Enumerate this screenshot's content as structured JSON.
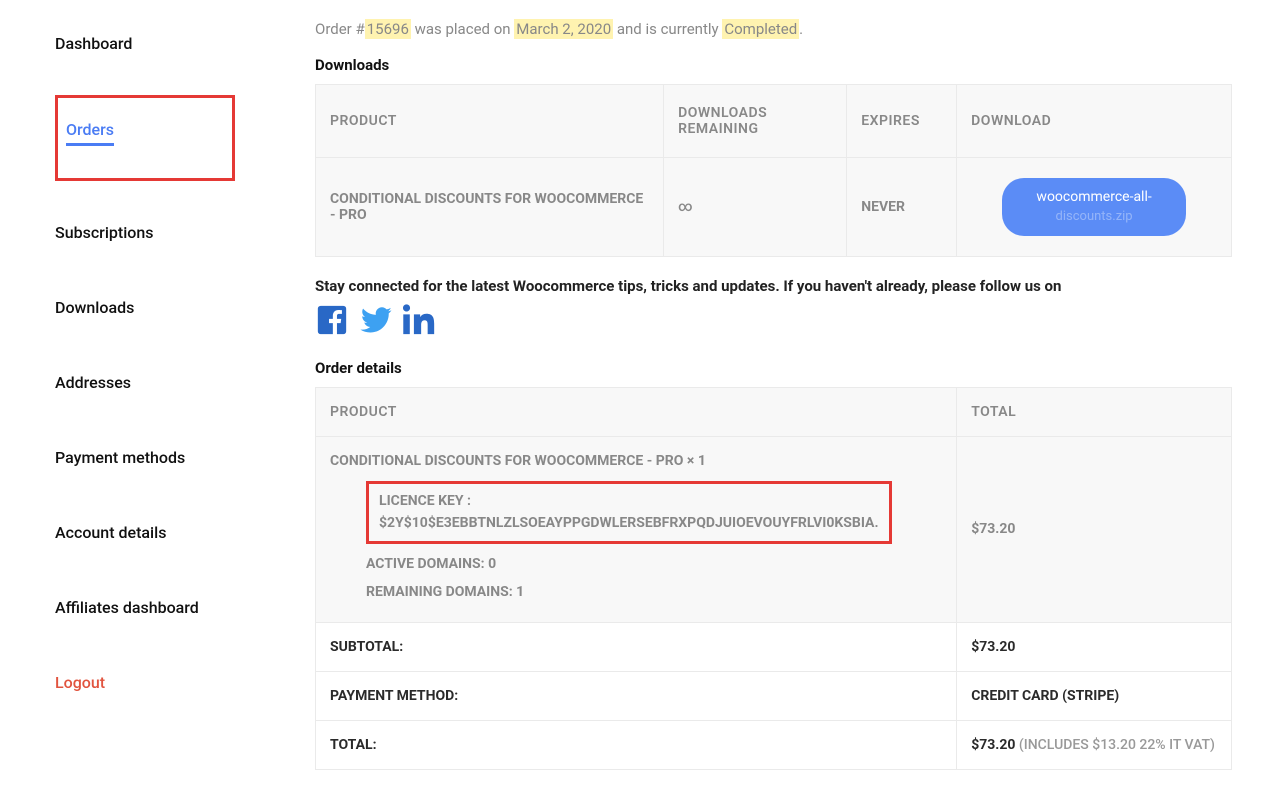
{
  "sidebar": {
    "items": [
      {
        "label": "Dashboard"
      },
      {
        "label": "Orders"
      },
      {
        "label": "Subscriptions"
      },
      {
        "label": "Downloads"
      },
      {
        "label": "Addresses"
      },
      {
        "label": "Payment methods"
      },
      {
        "label": "Account details"
      },
      {
        "label": "Affiliates dashboard"
      },
      {
        "label": "Logout"
      }
    ]
  },
  "order_status": {
    "prefix": "Order #",
    "number": "15696",
    "middle": " was placed on ",
    "date": "March 2, 2020",
    "suffix": " and is currently ",
    "status": "Completed",
    "end": "."
  },
  "downloads": {
    "title": "Downloads",
    "headers": {
      "product": "PRODUCT",
      "remaining": "DOWNLOADS REMAINING",
      "expires": "EXPIRES",
      "download": "DOWNLOAD"
    },
    "row": {
      "product": "CONDITIONAL DISCOUNTS FOR WOOCOMMERCE - PRO",
      "remaining": "∞",
      "expires": "NEVER",
      "download_label": "woocommerce-all-",
      "download_label_2": "discounts.zip"
    }
  },
  "social": {
    "text": "Stay connected for the latest Woocommerce tips, tricks and updates. If you haven't already, please follow us on"
  },
  "details": {
    "title": "Order details",
    "headers": {
      "product": "PRODUCT",
      "total": "TOTAL"
    },
    "product_line": "CONDITIONAL DISCOUNTS FOR WOOCOMMERCE - PRO × 1",
    "licence_label": "LICENCE KEY :",
    "licence_key": "$2Y$10$E3EBBTNLZLSOEAYPPGDWLERSEBFRXPQDJUIOEVOUYFRLVI0KSBIA.",
    "active_domains": "ACTIVE DOMAINS: 0",
    "remaining_domains": "REMAINING DOMAINS: 1",
    "line_total": "$73.20",
    "rows": {
      "subtotal_label": "SUBTOTAL:",
      "subtotal_value": "$73.20",
      "payment_label": "PAYMENT METHOD:",
      "payment_value": "CREDIT CARD (STRIPE)",
      "total_label": "TOTAL:",
      "total_value": "$73.20",
      "total_note": " (INCLUDES $13.20 22% IT VAT)"
    }
  }
}
